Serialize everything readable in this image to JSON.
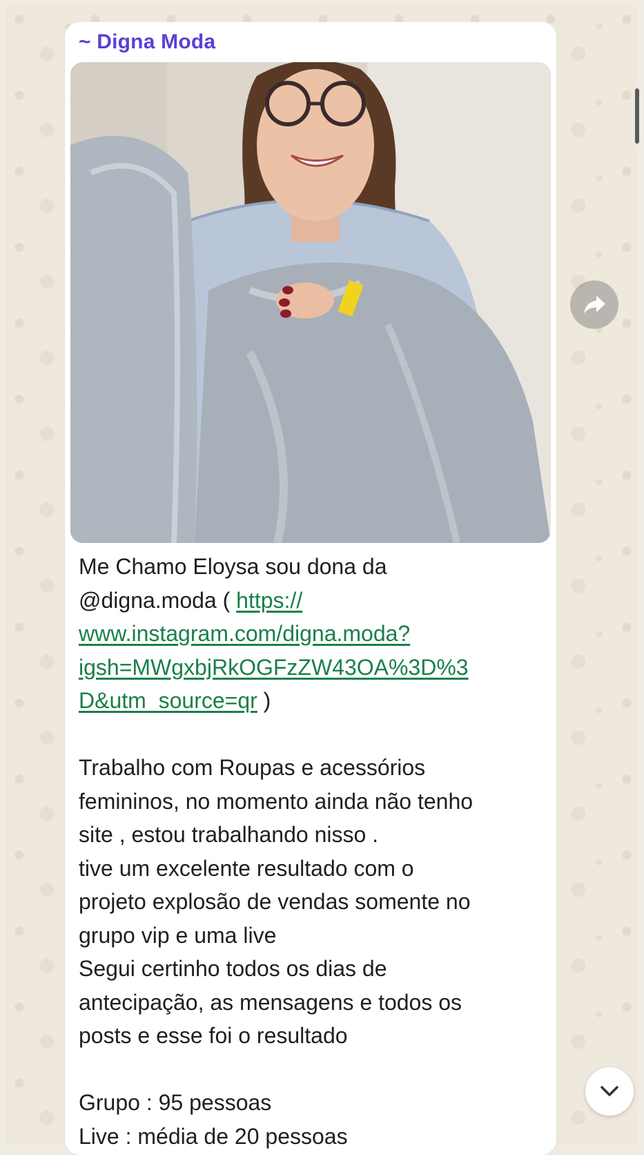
{
  "message": {
    "sender": "~ Digna Moda",
    "photo_alt": "",
    "lines": [
      {
        "type": "text",
        "text": "Me Chamo Eloysa sou dona da"
      },
      {
        "type": "mixed",
        "text": "@digna.moda ( ",
        "link": "https://"
      },
      {
        "type": "link",
        "text": "www.instagram.com/digna.moda?"
      },
      {
        "type": "link",
        "text": "igsh=MWgxbjRkOGFzZW43OA%3D%3"
      },
      {
        "type": "mixed-end",
        "link": "D&utm_source=qr",
        "text": " )"
      },
      {
        "type": "blank"
      },
      {
        "type": "text",
        "text": "Trabalho com Roupas e acessórios"
      },
      {
        "type": "text",
        "text": "femininos, no momento ainda não tenho"
      },
      {
        "type": "text",
        "text": "site , estou trabalhando nisso ."
      },
      {
        "type": "text",
        "text": "tive um excelente resultado com o"
      },
      {
        "type": "text",
        "text": "projeto explosão de vendas somente no"
      },
      {
        "type": "text",
        "text": "grupo vip e uma live"
      },
      {
        "type": "text",
        "text": "Segui certinho todos os dias de"
      },
      {
        "type": "text",
        "text": "antecipação, as mensagens e todos os"
      },
      {
        "type": "text",
        "text": "posts e esse foi o resultado"
      },
      {
        "type": "blank"
      },
      {
        "type": "text",
        "text": "Grupo : 95 pessoas"
      },
      {
        "type": "text",
        "text": "Live : média de 20 pessoas"
      }
    ]
  },
  "icons": {
    "forward": "forward-icon",
    "scroll_down": "chevron-down-icon"
  },
  "colors": {
    "sender": "#5b3fd6",
    "link": "#1a7f4b",
    "bubble": "#ffffff",
    "wallpaper": "#efe9dd"
  }
}
